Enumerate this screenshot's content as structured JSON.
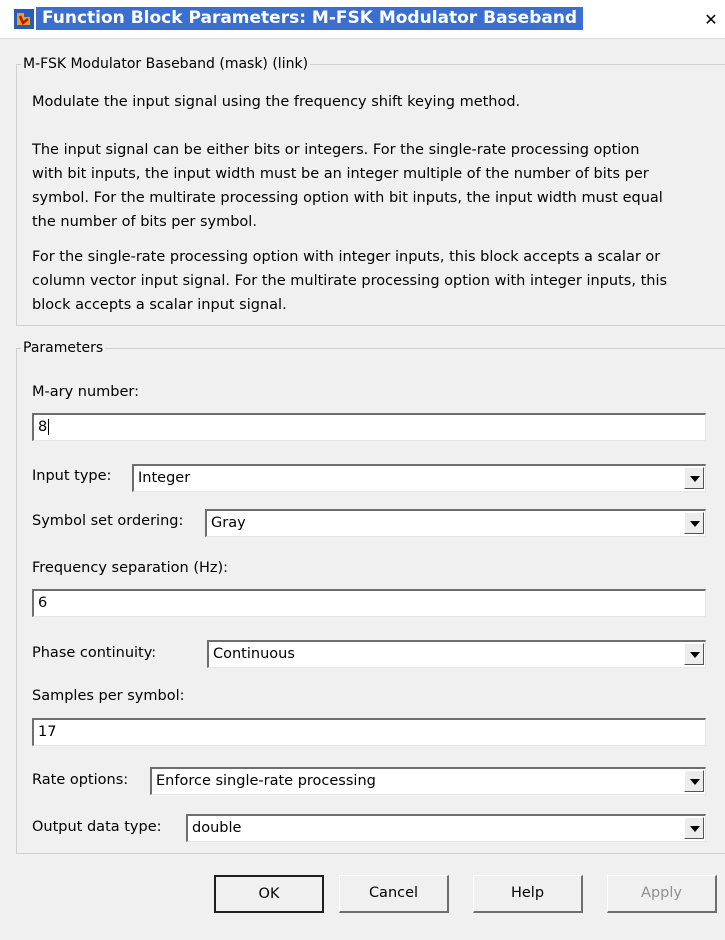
{
  "window": {
    "title": "Function Block Parameters: M-FSK Modulator Baseband",
    "close_glyph": "✕"
  },
  "mask_group": {
    "legend": "M-FSK Modulator Baseband (mask) (link)",
    "paragraph1": "Modulate the input signal using the frequency shift keying method.",
    "paragraph2_lines": [
      "The input signal can be either bits or integers.  For the single-rate processing option",
      "with bit inputs, the input width must be an integer multiple of the number of bits per",
      "symbol.  For the multirate processing option with bit inputs, the input width must equal",
      "the number of bits per symbol."
    ],
    "paragraph3_lines": [
      "For the single-rate processing option with integer inputs, this block accepts a scalar or",
      "column vector input signal.  For the multirate processing option with integer inputs, this",
      "block accepts a scalar input signal."
    ]
  },
  "params": {
    "legend": "Parameters",
    "mary_label": "M-ary number:",
    "mary_value": "8",
    "input_type_label": "Input type:",
    "input_type_value": "Integer",
    "symbol_order_label": "Symbol set ordering:",
    "symbol_order_value": "Gray",
    "freq_sep_label": "Frequency separation (Hz):",
    "freq_sep_value": "6",
    "phase_label": "Phase continuity:",
    "phase_value": "Continuous",
    "samples_label": "Samples per symbol:",
    "samples_value": "17",
    "rate_label": "Rate options:",
    "rate_value": "Enforce single-rate processing",
    "outtype_label": "Output data type:",
    "outtype_value": "double"
  },
  "buttons": {
    "ok": "OK",
    "cancel": "Cancel",
    "help": "Help",
    "apply": "Apply"
  },
  "colors": {
    "title_highlight": "#3a6fd0",
    "dialog_bg": "#f0f0f0"
  }
}
